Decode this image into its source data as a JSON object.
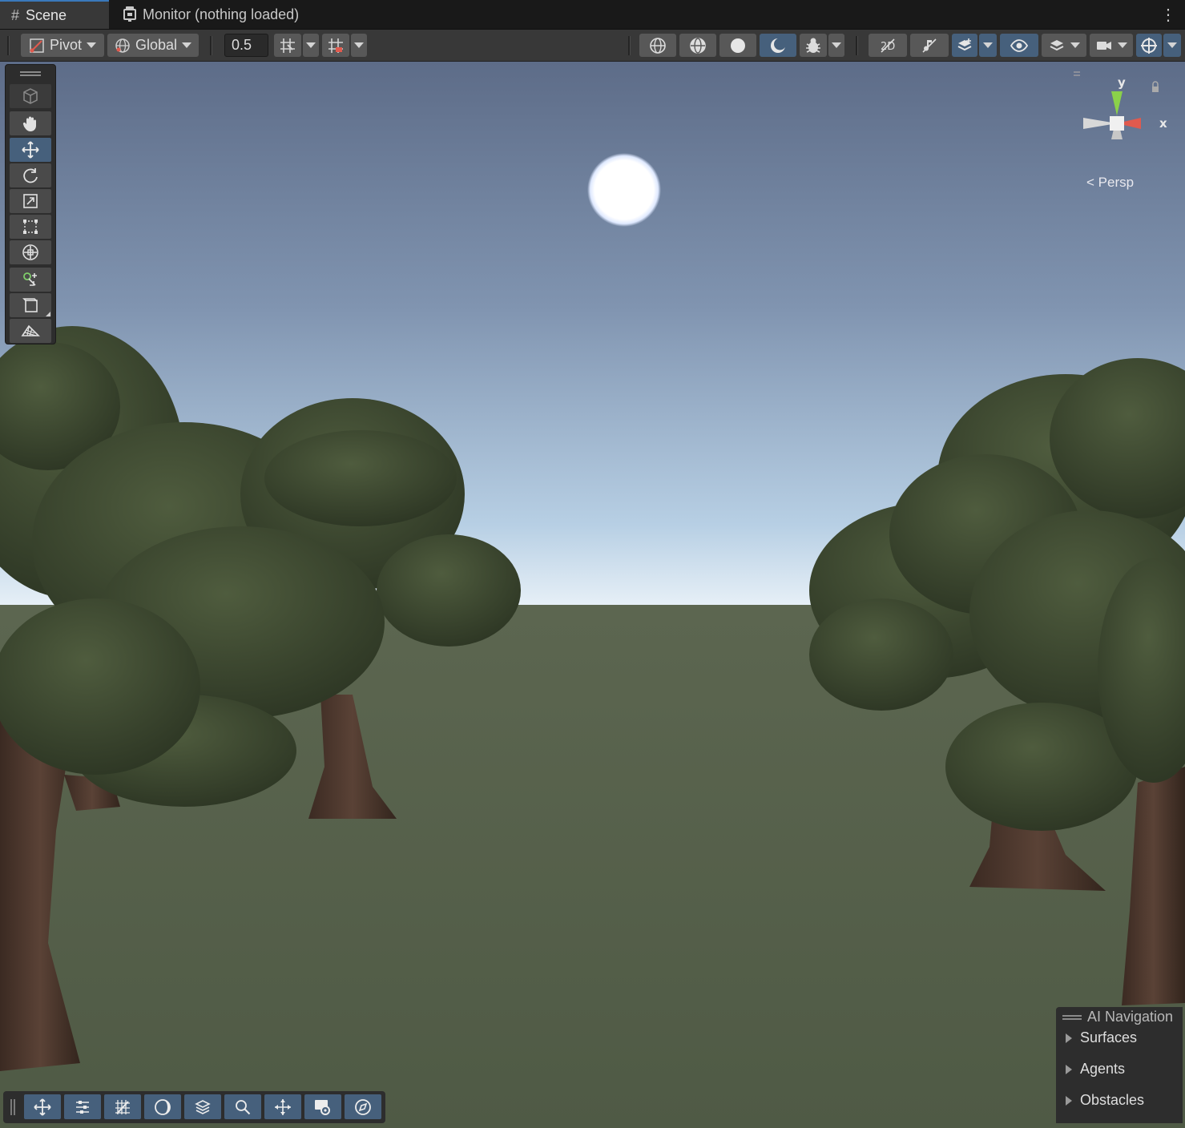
{
  "tabs": {
    "scene_label": "Scene",
    "monitor_label": "Monitor (nothing loaded)"
  },
  "toolbar": {
    "pivot_label": "Pivot",
    "global_label": "Global",
    "grid_snap_value": "0.5"
  },
  "gizmo": {
    "y_label": "y",
    "x_label": "x",
    "projection_label": "Persp"
  },
  "ai_navigation": {
    "title": "AI Navigation",
    "items": [
      "Surfaces",
      "Agents",
      "Obstacles"
    ]
  },
  "colors": {
    "accent": "#46607c",
    "toolbar_bg": "#383838",
    "panel_bg": "#2d2d2d",
    "gizmo_x": "#e05a4e",
    "gizmo_y": "#8bd14a"
  },
  "icons": {
    "left_tools": [
      "view-cube-icon",
      "hand-tool-icon",
      "move-tool-icon",
      "rotate-tool-icon",
      "scale-tool-icon",
      "rect-tool-icon",
      "transform-tool-icon",
      "custom-tool-icon",
      "draw-mode-icon",
      "terrain-tool-icon"
    ],
    "bottom_overlay": [
      "move-icon",
      "settings-sliders-icon",
      "grid-icon",
      "moon-icon",
      "layers-icon",
      "search-icon",
      "pivot-icon",
      "camera-icon",
      "compass-icon"
    ]
  }
}
